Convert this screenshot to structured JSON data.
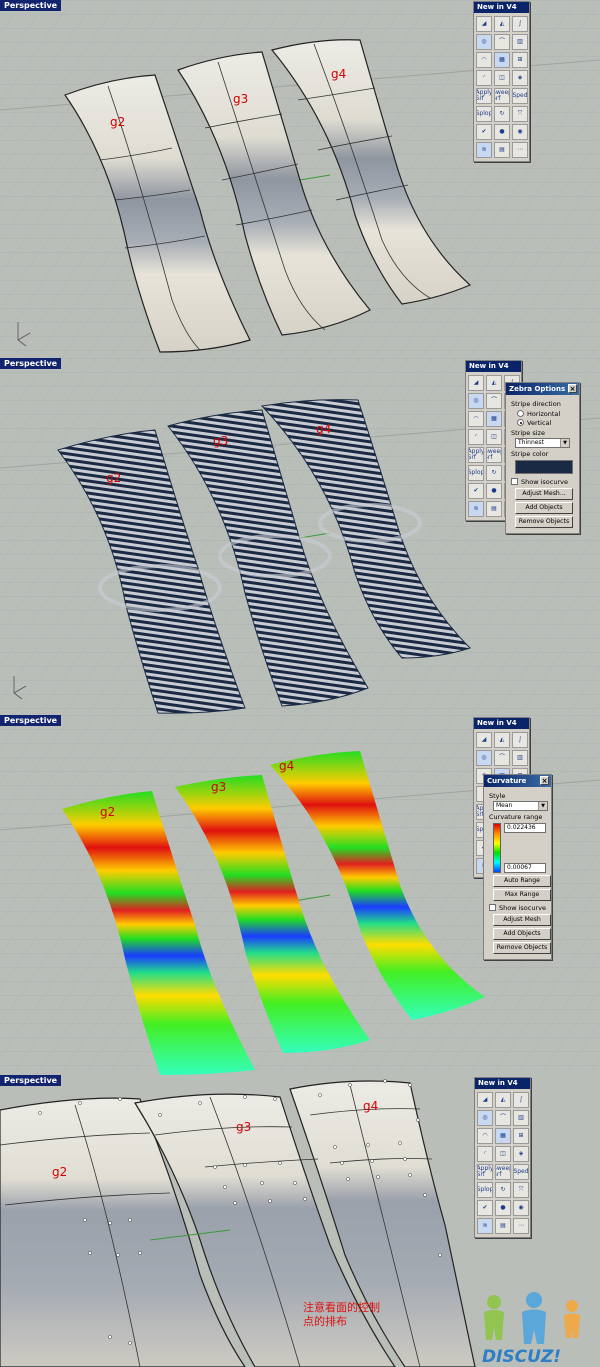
{
  "viewports": [
    {
      "tab": "Perspective",
      "labels": [
        "g2",
        "g3",
        "g4"
      ]
    },
    {
      "tab": "Perspective",
      "labels": [
        "g2",
        "g3",
        "g4"
      ]
    },
    {
      "tab": "Perspective",
      "labels": [
        "g2",
        "g3",
        "g4"
      ]
    },
    {
      "tab": "Perspective",
      "labels": [
        "g2",
        "g3",
        "g4"
      ]
    }
  ],
  "toolbar": {
    "title": "New in V4",
    "buttons": [
      "match-srf-icon",
      "blend-icon",
      "curve-icon",
      "swirl-icon",
      "arc-icon",
      "loft-icon",
      "sweep-icon",
      "patch-icon",
      "extend-icon",
      "fillet-icon",
      "network-icon",
      "shell-icon",
      "Apply Srf",
      "Sweep Srf",
      "Sped",
      "Splop",
      "rotate-icon",
      "scale-icon",
      "check-icon",
      "sphere-icon",
      "globe-icon",
      "zebra-icon",
      "mesh-icon",
      "more-icon"
    ]
  },
  "zebra_dialog": {
    "title": "Zebra Options",
    "stripe_direction_label": "Stripe direction",
    "horizontal_label": "Horizontal",
    "vertical_label": "Vertical",
    "stripe_size_label": "Stripe size",
    "stripe_size_value": "Thinnest",
    "stripe_color_label": "Stripe color",
    "stripe_color": "#1b2a44",
    "show_isocurve_label": "Show isocurve",
    "adjust_mesh_label": "Adjust Mesh...",
    "add_objects_label": "Add Objects",
    "remove_objects_label": "Remove Objects"
  },
  "curvature_dialog": {
    "title": "Curvature",
    "style_label": "Style",
    "style_value": "Mean",
    "range_label": "Curvature range",
    "range_max": "0.022436",
    "range_min": "0.00067",
    "auto_range_label": "Auto Range",
    "max_range_label": "Max Range",
    "show_isocurve_label": "Show isocurve",
    "adjust_mesh_label": "Adjust Mesh",
    "add_objects_label": "Add Objects",
    "remove_objects_label": "Remove Objects"
  },
  "annotation": {
    "line1": "注意看面的控制",
    "line2": "点的排布"
  },
  "watermark": {
    "text": "DISCUZ!"
  },
  "colors": {
    "background": "#b9beb9",
    "surface_light": "#e9e6dc",
    "surface_shade": "#8f96a0",
    "label_red": "#d40000",
    "viewport_tab": "#13246e"
  }
}
